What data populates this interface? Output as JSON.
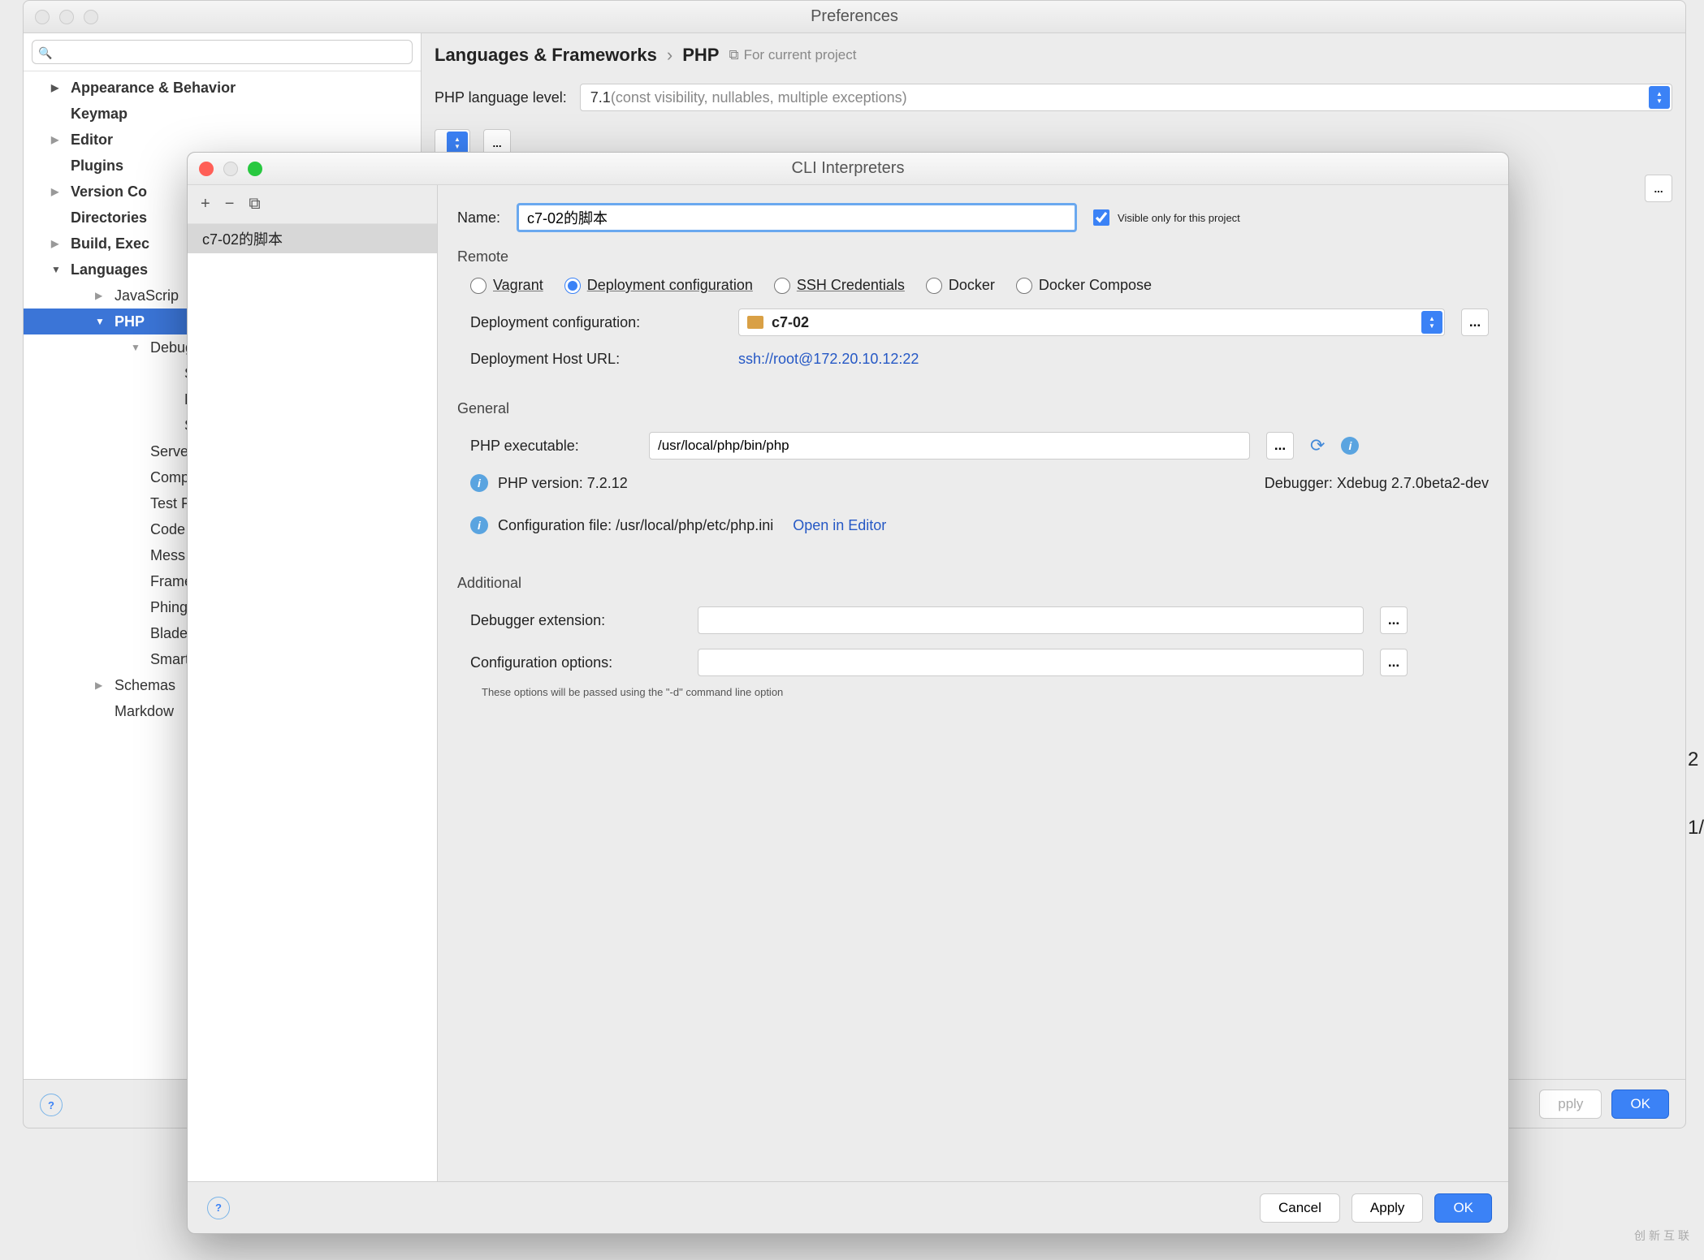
{
  "prefs": {
    "title": "Preferences",
    "search_placeholder": "",
    "breadcrumb": {
      "a": "Languages & Frameworks",
      "b": "PHP",
      "proj": "For current project"
    },
    "lang_level_label": "PHP language level:",
    "lang_level_value": "7.1",
    "lang_level_hint": " (const visibility, nullables, multiple exceptions)",
    "tree": [
      {
        "label": "Appearance & Behavior",
        "lvl": 1,
        "arr": "▶",
        "bold": true
      },
      {
        "label": "Keymap",
        "lvl": 1,
        "arr": "",
        "bold": true
      },
      {
        "label": "Editor",
        "lvl": 1,
        "arr": "▶",
        "bold": true,
        "gray": true
      },
      {
        "label": "Plugins",
        "lvl": 1,
        "arr": "",
        "bold": true
      },
      {
        "label": "Version Co",
        "lvl": 1,
        "arr": "▶",
        "bold": true,
        "gray": true
      },
      {
        "label": "Directories",
        "lvl": 1,
        "arr": "",
        "bold": true
      },
      {
        "label": "Build, Exec",
        "lvl": 1,
        "arr": "▶",
        "bold": true,
        "gray": true
      },
      {
        "label": "Languages",
        "lvl": 1,
        "arr": "▼",
        "bold": true
      },
      {
        "label": "JavaScrip",
        "lvl": 2,
        "arr": "▶",
        "gray": true
      },
      {
        "label": "PHP",
        "lvl": 2,
        "arr": "▼",
        "bold": true,
        "sel": true
      },
      {
        "label": "Debug",
        "lvl": 3,
        "arr": "▼",
        "gray": true
      },
      {
        "label": "Skip",
        "lvl": 4,
        "arr": ""
      },
      {
        "label": "DBG",
        "lvl": 4,
        "arr": ""
      },
      {
        "label": "Step",
        "lvl": 4,
        "arr": ""
      },
      {
        "label": "Server",
        "lvl": 3,
        "arr": ""
      },
      {
        "label": "Compo",
        "lvl": 3,
        "arr": ""
      },
      {
        "label": "Test F",
        "lvl": 3,
        "arr": ""
      },
      {
        "label": "Code S",
        "lvl": 3,
        "arr": ""
      },
      {
        "label": "Mess D",
        "lvl": 3,
        "arr": ""
      },
      {
        "label": "Frame",
        "lvl": 3,
        "arr": ""
      },
      {
        "label": "Phing",
        "lvl": 3,
        "arr": ""
      },
      {
        "label": "Blade",
        "lvl": 3,
        "arr": ""
      },
      {
        "label": "Smarty",
        "lvl": 3,
        "arr": ""
      },
      {
        "label": "Schemas",
        "lvl": 2,
        "arr": "▶",
        "gray": true
      },
      {
        "label": "Markdow",
        "lvl": 2,
        "arr": ""
      }
    ],
    "buttons": {
      "apply": "pply",
      "ok": "OK"
    }
  },
  "cli": {
    "title": "CLI Interpreters",
    "list_item": "c7-02的脚本",
    "name_label": "Name:",
    "name_value": "c7-02的脚本",
    "visible_label": "Visible only for this project",
    "remote_h": "Remote",
    "radios": {
      "vagrant": "Vagrant",
      "deploy": "Deployment configuration",
      "ssh": "SSH Credentials",
      "docker": "Docker",
      "compose": "Docker Compose"
    },
    "dep_conf_label": "Deployment configuration:",
    "dep_conf_value": "c7-02",
    "dep_host_label": "Deployment Host URL:",
    "dep_host_value": "ssh://root@172.20.10.12:22",
    "general_h": "General",
    "php_exec_label": "PHP executable:",
    "php_exec_value": "/usr/local/php/bin/php",
    "php_version": "PHP version: 7.2.12",
    "debugger": "Debugger: Xdebug 2.7.0beta2-dev",
    "conf_file_label": "Configuration file: ",
    "conf_file_value": "/usr/local/php/etc/php.ini",
    "open_editor": "Open in Editor",
    "additional_h": "Additional",
    "dbg_ext_label": "Debugger extension:",
    "conf_opt_label": "Configuration options:",
    "note": "These options will be passed using the \"-d\" command line option",
    "buttons": {
      "cancel": "Cancel",
      "apply": "Apply",
      "ok": "OK"
    }
  },
  "glyphs": {
    "browse": "...",
    "plus": "+",
    "minus": "−",
    "copy": "⧉",
    "reload": "⟳",
    "info": "i",
    "help": "?"
  },
  "truncated": {
    "right0": "2",
    "right1": "1/"
  }
}
